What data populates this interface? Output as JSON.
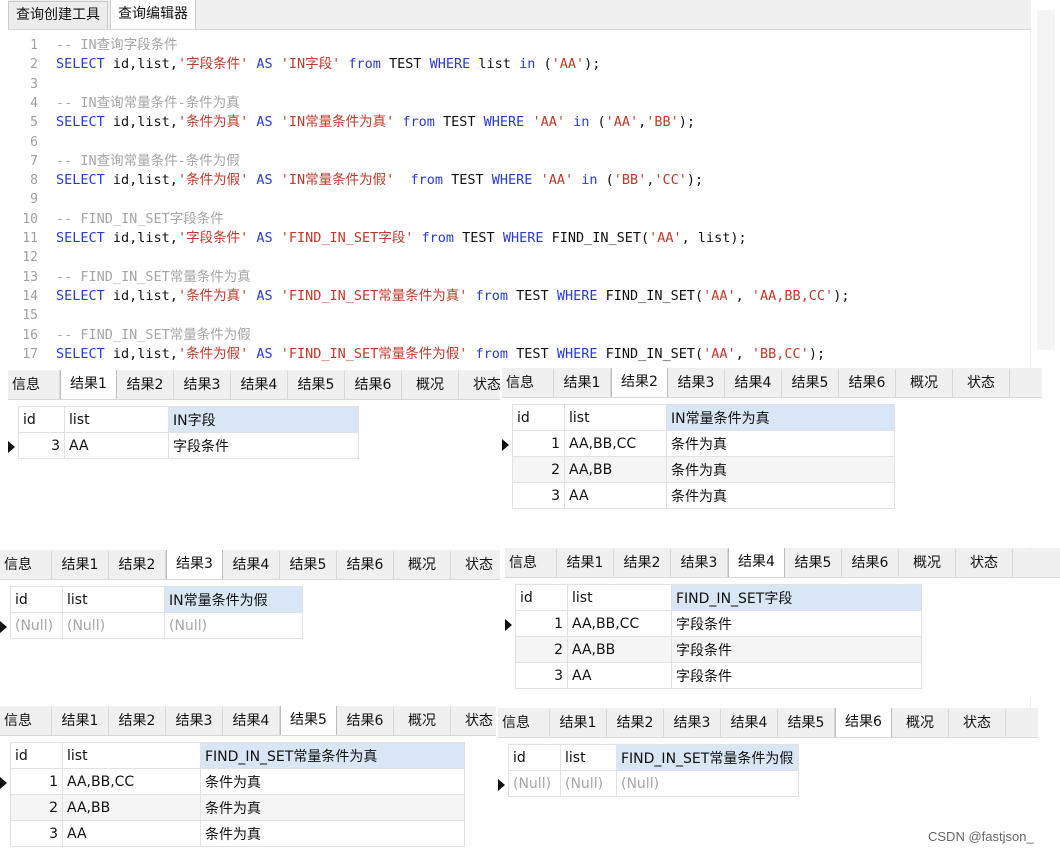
{
  "top_tabs": [
    "查询创建工具",
    "查询编辑器"
  ],
  "editor_lines": [
    {
      "n": "1",
      "tokens": [
        {
          "t": "-- IN查询字段条件",
          "c": "cmt"
        }
      ]
    },
    {
      "n": "2",
      "tokens": [
        {
          "t": "SELECT",
          "c": "kw"
        },
        {
          "t": " id,list,",
          "c": "id"
        },
        {
          "t": "'字段条件'",
          "c": "str"
        },
        {
          "t": " AS ",
          "c": "kw"
        },
        {
          "t": "'IN字段'",
          "c": "str"
        },
        {
          "t": " from ",
          "c": "kw"
        },
        {
          "t": "TEST ",
          "c": "id"
        },
        {
          "t": "WHERE",
          "c": "kw"
        },
        {
          "t": " list ",
          "c": "id"
        },
        {
          "t": "in",
          "c": "kw"
        },
        {
          "t": " (",
          "c": "id"
        },
        {
          "t": "'AA'",
          "c": "str"
        },
        {
          "t": ");",
          "c": "id"
        }
      ]
    },
    {
      "n": "3",
      "tokens": []
    },
    {
      "n": "4",
      "tokens": [
        {
          "t": "-- IN查询常量条件-条件为真",
          "c": "cmt"
        }
      ]
    },
    {
      "n": "5",
      "tokens": [
        {
          "t": "SELECT",
          "c": "kw"
        },
        {
          "t": " id,list,",
          "c": "id"
        },
        {
          "t": "'条件为真'",
          "c": "str"
        },
        {
          "t": " AS ",
          "c": "kw"
        },
        {
          "t": "'IN常量条件为真'",
          "c": "str"
        },
        {
          "t": " from ",
          "c": "kw"
        },
        {
          "t": "TEST ",
          "c": "id"
        },
        {
          "t": "WHERE",
          "c": "kw"
        },
        {
          "t": " ",
          "c": "id"
        },
        {
          "t": "'AA'",
          "c": "str"
        },
        {
          "t": " in",
          "c": "kw"
        },
        {
          "t": " (",
          "c": "id"
        },
        {
          "t": "'AA'",
          "c": "str"
        },
        {
          "t": ",",
          "c": "id"
        },
        {
          "t": "'BB'",
          "c": "str"
        },
        {
          "t": ");",
          "c": "id"
        }
      ]
    },
    {
      "n": "6",
      "tokens": []
    },
    {
      "n": "7",
      "tokens": [
        {
          "t": "-- IN查询常量条件-条件为假",
          "c": "cmt"
        }
      ]
    },
    {
      "n": "8",
      "tokens": [
        {
          "t": "SELECT",
          "c": "kw"
        },
        {
          "t": " id,list,",
          "c": "id"
        },
        {
          "t": "'条件为假'",
          "c": "str"
        },
        {
          "t": " AS ",
          "c": "kw"
        },
        {
          "t": "'IN常量条件为假'",
          "c": "str"
        },
        {
          "t": "  from ",
          "c": "kw"
        },
        {
          "t": "TEST ",
          "c": "id"
        },
        {
          "t": "WHERE",
          "c": "kw"
        },
        {
          "t": " ",
          "c": "id"
        },
        {
          "t": "'AA'",
          "c": "str"
        },
        {
          "t": " in",
          "c": "kw"
        },
        {
          "t": " (",
          "c": "id"
        },
        {
          "t": "'BB'",
          "c": "str"
        },
        {
          "t": ",",
          "c": "id"
        },
        {
          "t": "'CC'",
          "c": "str"
        },
        {
          "t": ");",
          "c": "id"
        }
      ]
    },
    {
      "n": "9",
      "tokens": []
    },
    {
      "n": "10",
      "tokens": [
        {
          "t": "-- FIND_IN_SET字段条件",
          "c": "cmt"
        }
      ]
    },
    {
      "n": "11",
      "tokens": [
        {
          "t": "SELECT",
          "c": "kw"
        },
        {
          "t": " id,list,",
          "c": "id"
        },
        {
          "t": "'字段条件'",
          "c": "str"
        },
        {
          "t": " AS ",
          "c": "kw"
        },
        {
          "t": "'FIND_IN_SET字段'",
          "c": "str"
        },
        {
          "t": " from ",
          "c": "kw"
        },
        {
          "t": "TEST ",
          "c": "id"
        },
        {
          "t": "WHERE",
          "c": "kw"
        },
        {
          "t": " FIND_IN_SET(",
          "c": "id"
        },
        {
          "t": "'AA'",
          "c": "str"
        },
        {
          "t": ", list);",
          "c": "id"
        }
      ]
    },
    {
      "n": "12",
      "tokens": []
    },
    {
      "n": "13",
      "tokens": [
        {
          "t": "-- FIND_IN_SET常量条件为真",
          "c": "cmt"
        }
      ]
    },
    {
      "n": "14",
      "tokens": [
        {
          "t": "SELECT",
          "c": "kw"
        },
        {
          "t": " id,list,",
          "c": "id"
        },
        {
          "t": "'条件为真'",
          "c": "str"
        },
        {
          "t": " AS ",
          "c": "kw"
        },
        {
          "t": "'FIND_IN_SET常量条件为真'",
          "c": "str"
        },
        {
          "t": " from ",
          "c": "kw"
        },
        {
          "t": "TEST ",
          "c": "id"
        },
        {
          "t": "WHERE",
          "c": "kw"
        },
        {
          "t": " FIND_IN_SET(",
          "c": "id"
        },
        {
          "t": "'AA'",
          "c": "str"
        },
        {
          "t": ", ",
          "c": "id"
        },
        {
          "t": "'AA,BB,CC'",
          "c": "str"
        },
        {
          "t": ");",
          "c": "id"
        }
      ]
    },
    {
      "n": "15",
      "tokens": []
    },
    {
      "n": "16",
      "tokens": [
        {
          "t": "-- FIND_IN_SET常量条件为假",
          "c": "cmt"
        }
      ]
    },
    {
      "n": "17",
      "tokens": [
        {
          "t": "SELECT",
          "c": "kw"
        },
        {
          "t": " id,list,",
          "c": "id"
        },
        {
          "t": "'条件为假'",
          "c": "str"
        },
        {
          "t": " AS ",
          "c": "kw"
        },
        {
          "t": "'FIND_IN_SET常量条件为假'",
          "c": "str"
        },
        {
          "t": " from ",
          "c": "kw"
        },
        {
          "t": "TEST ",
          "c": "id"
        },
        {
          "t": "WHERE",
          "c": "kw"
        },
        {
          "t": " FIND_IN_SET(",
          "c": "id"
        },
        {
          "t": "'AA'",
          "c": "str"
        },
        {
          "t": ", ",
          "c": "id"
        },
        {
          "t": "'BB,CC'",
          "c": "str"
        },
        {
          "t": ");",
          "c": "id"
        }
      ]
    }
  ],
  "result_tabs": [
    "信息",
    "结果1",
    "结果2",
    "结果3",
    "结果4",
    "结果5",
    "结果6",
    "概况",
    "状态"
  ],
  "panels": [
    {
      "active": 1,
      "columns": [
        "id",
        "list",
        "IN字段"
      ],
      "rows": [
        [
          "3",
          "AA",
          "字段条件"
        ]
      ],
      "null_row": false
    },
    {
      "active": 2,
      "columns": [
        "id",
        "list",
        "IN常量条件为真"
      ],
      "rows": [
        [
          "1",
          "AA,BB,CC",
          "条件为真"
        ],
        [
          "2",
          "AA,BB",
          "条件为真"
        ],
        [
          "3",
          "AA",
          "条件为真"
        ]
      ],
      "null_row": false
    },
    {
      "active": 3,
      "columns": [
        "id",
        "list",
        "IN常量条件为假"
      ],
      "rows": [
        [
          "(Null)",
          "(Null)",
          "(Null)"
        ]
      ],
      "null_row": true
    },
    {
      "active": 4,
      "columns": [
        "id",
        "list",
        "FIND_IN_SET字段"
      ],
      "rows": [
        [
          "1",
          "AA,BB,CC",
          "字段条件"
        ],
        [
          "2",
          "AA,BB",
          "字段条件"
        ],
        [
          "3",
          "AA",
          "字段条件"
        ]
      ],
      "null_row": false
    },
    {
      "active": 5,
      "columns": [
        "id",
        "list",
        "FIND_IN_SET常量条件为真"
      ],
      "rows": [
        [
          "1",
          "AA,BB,CC",
          "条件为真"
        ],
        [
          "2",
          "AA,BB",
          "条件为真"
        ],
        [
          "3",
          "AA",
          "条件为真"
        ]
      ],
      "null_row": false
    },
    {
      "active": 6,
      "columns": [
        "id",
        "list",
        "FIND_IN_SET常量条件为假"
      ],
      "rows": [
        [
          "(Null)",
          "(Null)",
          "(Null)"
        ]
      ],
      "null_row": true
    }
  ],
  "watermark": "CSDN @fastjson_"
}
